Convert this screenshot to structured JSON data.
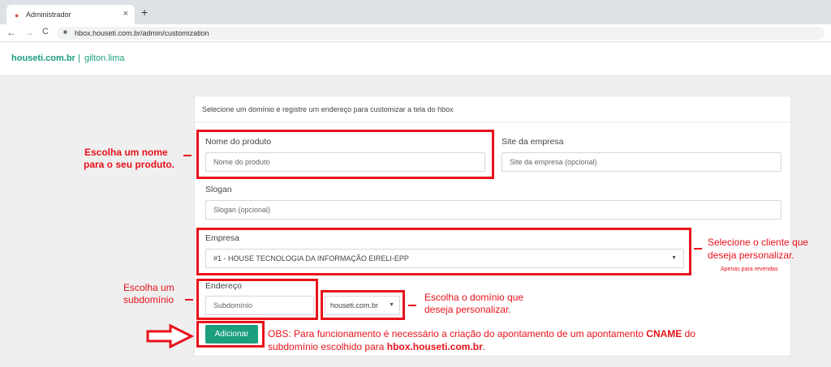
{
  "browser": {
    "tab_title": "Administrador",
    "tab_close": "×",
    "new_tab": "+",
    "back": "←",
    "forward": "→",
    "reload": "C",
    "url": "hbox.houseti.com.br/admin/customization"
  },
  "header": {
    "domain": "houseti.com.br",
    "separator": "|",
    "user": "gilton.lima"
  },
  "card": {
    "title": "Selecione um domínio e registre um endereço para customizar a tela do hbox",
    "product_label": "Nome do produto",
    "product_placeholder": "Nome do produto",
    "site_label": "Site da empresa",
    "site_placeholder": "Site da empresa (opcional)",
    "slogan_label": "Slogan",
    "slogan_placeholder": "Slogan (opcional)",
    "company_label": "Empresa",
    "company_value": "#1 - HOUSE TECNOLOGIA DA INFORMAÇÃO EIRELI-EPP",
    "address_label": "Endereço",
    "subdomain_placeholder": "Subdomínio",
    "domain_value": "houseti.com.br",
    "submit_label": "Adicionar"
  },
  "annotations": {
    "product_note_1": "Escolha um nome",
    "product_note_2": "para o seu produto.",
    "client_note_1": "Selecione o cliente que",
    "client_note_2": "deseja personalizar.",
    "client_note_small": "Apenas para revendas",
    "subdomain_note_1": "Escolha um",
    "subdomain_note_2": "subdomínio",
    "domain_note_1": "Escolha o domínio que",
    "domain_note_2": "deseja personalizar.",
    "obs_1a": "OBS: Para funcionamento é necessário a criação do apontamento de um apontamento ",
    "obs_1b": "CNAME",
    "obs_1c": " do",
    "obs_2a": "subdomínio escolhido para ",
    "obs_2b": "hbox.houseti.com.br",
    "obs_2c": "."
  },
  "colors": {
    "accent": "#1a9e7e",
    "annotation": "#e8111a"
  }
}
